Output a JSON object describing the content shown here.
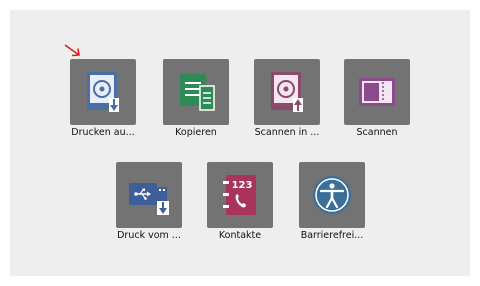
{
  "apps": [
    {
      "label": "Drucken au...",
      "icon": "print-from-storage-icon"
    },
    {
      "label": "Kopieren",
      "icon": "copy-icon"
    },
    {
      "label": "Scannen in ...",
      "icon": "scan-to-storage-icon"
    },
    {
      "label": "Scannen",
      "icon": "scan-icon"
    },
    {
      "label": "Druck vom ...",
      "icon": "print-from-usb-icon"
    },
    {
      "label": "Kontakte",
      "icon": "contacts-icon"
    },
    {
      "label": "Barrierefrei...",
      "icon": "accessibility-icon"
    }
  ],
  "contacts_icon_text": "123",
  "colors": {
    "tile_bg": "#737373",
    "print_storage": "#4a6fa5",
    "copy": "#2e8b57",
    "scan_storage": "#8b4a6b",
    "scan": "#8b4a8b",
    "usb": "#3d5e99",
    "contacts": "#a8345a",
    "accessibility": "#3a6f9a",
    "arrow": "#e02020"
  }
}
